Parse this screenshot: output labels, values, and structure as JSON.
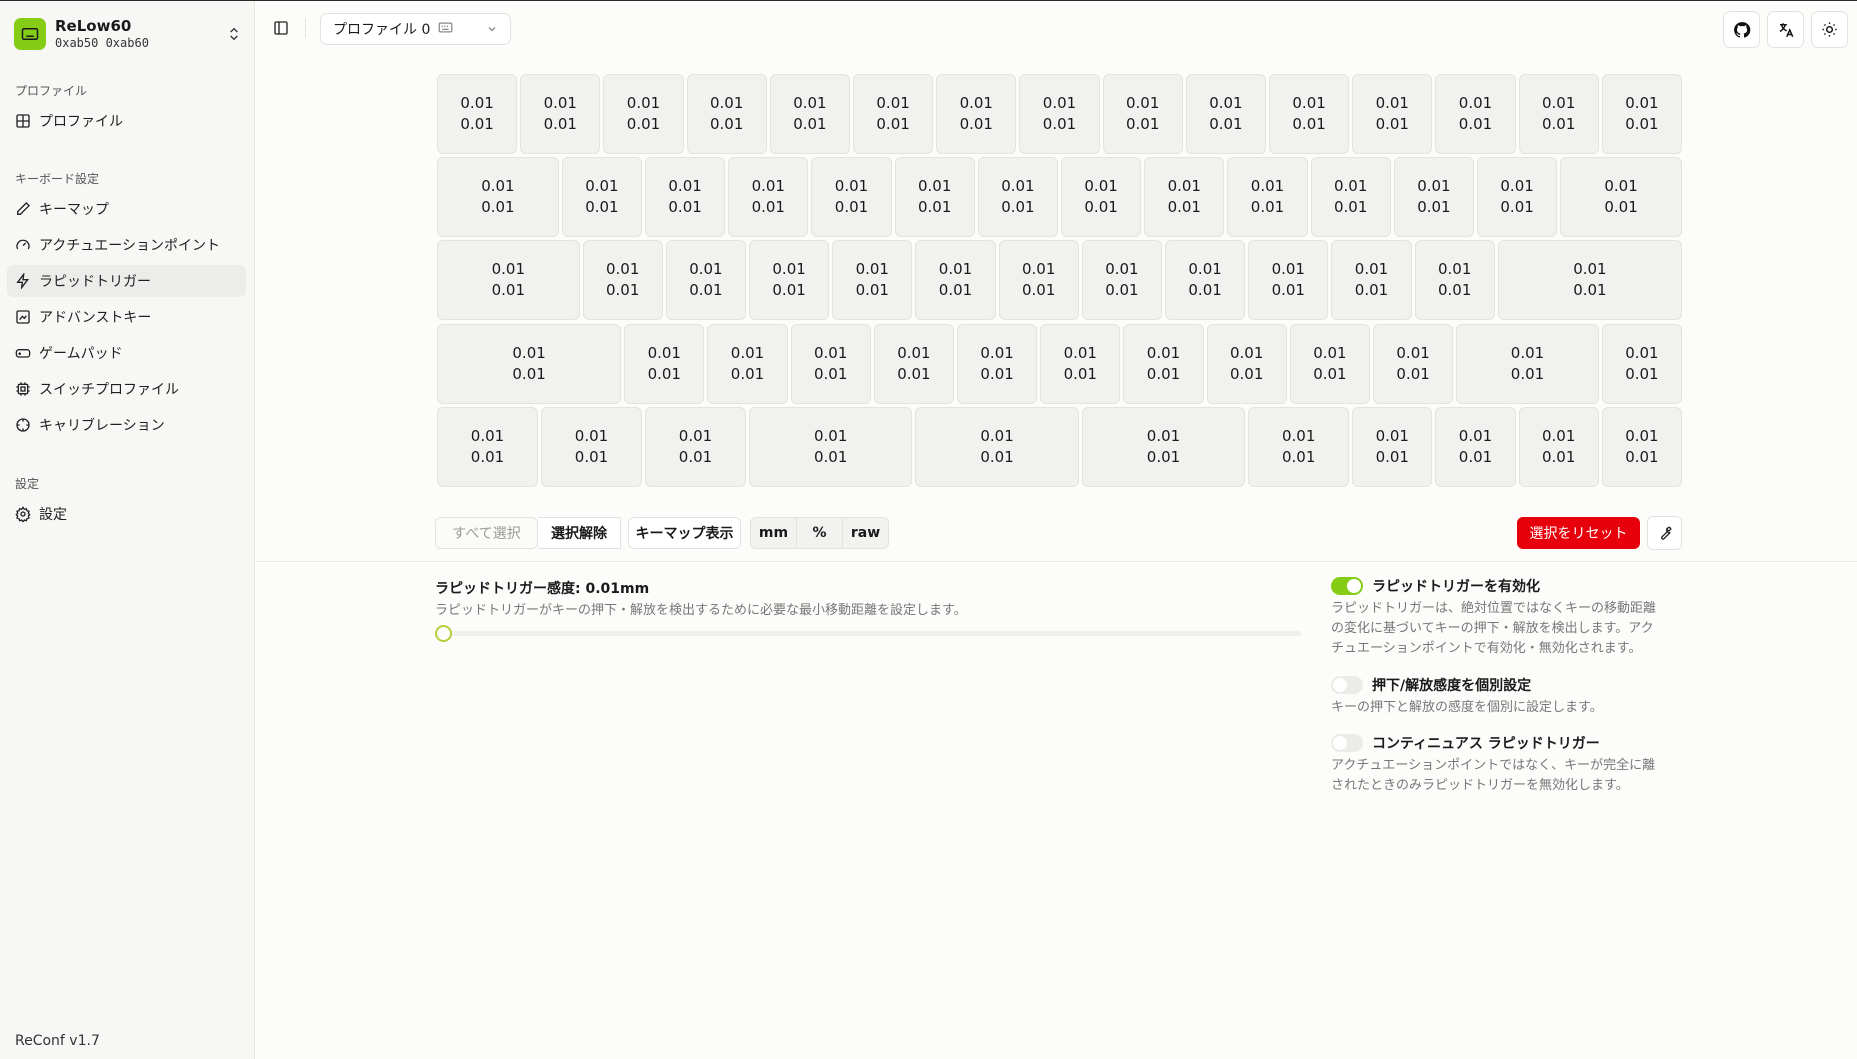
{
  "device": {
    "name": "ReLow60",
    "id": "0xab50 0xab60"
  },
  "sidebar": {
    "sections": [
      {
        "label": "プロファイル"
      },
      {
        "label": "キーボード設定"
      },
      {
        "label": "設定"
      }
    ],
    "items": [
      {
        "label": "プロファイル",
        "icon": "grid-icon"
      },
      {
        "label": "キーマップ",
        "icon": "pencil-icon"
      },
      {
        "label": "アクチュエーションポイント",
        "icon": "gauge-icon"
      },
      {
        "label": "ラピッドトリガー",
        "icon": "zap-icon",
        "active": true
      },
      {
        "label": "アドバンストキー",
        "icon": "chart-square-icon"
      },
      {
        "label": "ゲームパッド",
        "icon": "gamepad-icon"
      },
      {
        "label": "スイッチプロファイル",
        "icon": "cpu-icon"
      },
      {
        "label": "キャリブレーション",
        "icon": "crosshair-icon"
      },
      {
        "label": "設定",
        "icon": "gear-icon"
      }
    ],
    "version": "ReConf v1.7"
  },
  "topbar": {
    "profile_label": "プロファイル 0",
    "github_icon": "github-icon",
    "language_icon": "translate-icon",
    "theme_icon": "sun-icon"
  },
  "keyboard": {
    "rows": [
      [
        {
          "w": 1,
          "a": "0.01",
          "b": "0.01"
        },
        {
          "w": 1,
          "a": "0.01",
          "b": "0.01"
        },
        {
          "w": 1,
          "a": "0.01",
          "b": "0.01"
        },
        {
          "w": 1,
          "a": "0.01",
          "b": "0.01"
        },
        {
          "w": 1,
          "a": "0.01",
          "b": "0.01"
        },
        {
          "w": 1,
          "a": "0.01",
          "b": "0.01"
        },
        {
          "w": 1,
          "a": "0.01",
          "b": "0.01"
        },
        {
          "w": 1,
          "a": "0.01",
          "b": "0.01"
        },
        {
          "w": 1,
          "a": "0.01",
          "b": "0.01"
        },
        {
          "w": 1,
          "a": "0.01",
          "b": "0.01"
        },
        {
          "w": 1,
          "a": "0.01",
          "b": "0.01"
        },
        {
          "w": 1,
          "a": "0.01",
          "b": "0.01"
        },
        {
          "w": 1,
          "a": "0.01",
          "b": "0.01"
        },
        {
          "w": 1,
          "a": "0.01",
          "b": "0.01"
        },
        {
          "w": 1,
          "a": "0.01",
          "b": "0.01"
        }
      ],
      [
        {
          "w": 1.5,
          "a": "0.01",
          "b": "0.01"
        },
        {
          "w": 1,
          "a": "0.01",
          "b": "0.01"
        },
        {
          "w": 1,
          "a": "0.01",
          "b": "0.01"
        },
        {
          "w": 1,
          "a": "0.01",
          "b": "0.01"
        },
        {
          "w": 1,
          "a": "0.01",
          "b": "0.01"
        },
        {
          "w": 1,
          "a": "0.01",
          "b": "0.01"
        },
        {
          "w": 1,
          "a": "0.01",
          "b": "0.01"
        },
        {
          "w": 1,
          "a": "0.01",
          "b": "0.01"
        },
        {
          "w": 1,
          "a": "0.01",
          "b": "0.01"
        },
        {
          "w": 1,
          "a": "0.01",
          "b": "0.01"
        },
        {
          "w": 1,
          "a": "0.01",
          "b": "0.01"
        },
        {
          "w": 1,
          "a": "0.01",
          "b": "0.01"
        },
        {
          "w": 1,
          "a": "0.01",
          "b": "0.01"
        },
        {
          "w": 1.5,
          "a": "0.01",
          "b": "0.01"
        }
      ],
      [
        {
          "w": 1.75,
          "a": "0.01",
          "b": "0.01"
        },
        {
          "w": 1,
          "a": "0.01",
          "b": "0.01"
        },
        {
          "w": 1,
          "a": "0.01",
          "b": "0.01"
        },
        {
          "w": 1,
          "a": "0.01",
          "b": "0.01"
        },
        {
          "w": 1,
          "a": "0.01",
          "b": "0.01"
        },
        {
          "w": 1,
          "a": "0.01",
          "b": "0.01"
        },
        {
          "w": 1,
          "a": "0.01",
          "b": "0.01"
        },
        {
          "w": 1,
          "a": "0.01",
          "b": "0.01"
        },
        {
          "w": 1,
          "a": "0.01",
          "b": "0.01"
        },
        {
          "w": 1,
          "a": "0.01",
          "b": "0.01"
        },
        {
          "w": 1,
          "a": "0.01",
          "b": "0.01"
        },
        {
          "w": 1,
          "a": "0.01",
          "b": "0.01"
        },
        {
          "w": 2.25,
          "a": "0.01",
          "b": "0.01"
        }
      ],
      [
        {
          "w": 2.25,
          "a": "0.01",
          "b": "0.01"
        },
        {
          "w": 1,
          "a": "0.01",
          "b": "0.01"
        },
        {
          "w": 1,
          "a": "0.01",
          "b": "0.01"
        },
        {
          "w": 1,
          "a": "0.01",
          "b": "0.01"
        },
        {
          "w": 1,
          "a": "0.01",
          "b": "0.01"
        },
        {
          "w": 1,
          "a": "0.01",
          "b": "0.01"
        },
        {
          "w": 1,
          "a": "0.01",
          "b": "0.01"
        },
        {
          "w": 1,
          "a": "0.01",
          "b": "0.01"
        },
        {
          "w": 1,
          "a": "0.01",
          "b": "0.01"
        },
        {
          "w": 1,
          "a": "0.01",
          "b": "0.01"
        },
        {
          "w": 1,
          "a": "0.01",
          "b": "0.01"
        },
        {
          "w": 1.75,
          "a": "0.01",
          "b": "0.01"
        },
        {
          "w": 1,
          "a": "0.01",
          "b": "0.01"
        }
      ],
      [
        {
          "w": 1.25,
          "a": "0.01",
          "b": "0.01"
        },
        {
          "w": 1.25,
          "a": "0.01",
          "b": "0.01"
        },
        {
          "w": 1.25,
          "a": "0.01",
          "b": "0.01"
        },
        {
          "w": 2,
          "a": "0.01",
          "b": "0.01"
        },
        {
          "w": 2,
          "a": "0.01",
          "b": "0.01"
        },
        {
          "w": 2,
          "a": "0.01",
          "b": "0.01"
        },
        {
          "w": 1.25,
          "a": "0.01",
          "b": "0.01"
        },
        {
          "w": 1,
          "a": "0.01",
          "b": "0.01"
        },
        {
          "w": 1,
          "a": "0.01",
          "b": "0.01"
        },
        {
          "w": 1,
          "a": "0.01",
          "b": "0.01"
        },
        {
          "w": 1,
          "a": "0.01",
          "b": "0.01"
        }
      ]
    ]
  },
  "toolbar": {
    "select_all": "すべて選択",
    "deselect": "選択解除",
    "show_keymap": "キーマップ表示",
    "units": [
      "mm",
      "%",
      "raw"
    ],
    "reset": "選択をリセット",
    "wrench_icon": "wrench-icon"
  },
  "sensitivity": {
    "title": "ラピッドトリガー感度: 0.01mm",
    "description": "ラピッドトリガーがキーの押下・解放を検出するために必要な最小移動距離を設定します。",
    "slider_fraction": 0
  },
  "options": [
    {
      "title": "ラピッドトリガーを有効化",
      "on": true,
      "desc_lines": [
        "ラピッドトリガーは、絶対位置ではなくキーの移動距離",
        "の変化に基づいてキーの押下・解放を検出します。アク",
        "チュエーションポイントで有効化・無効化されます。"
      ]
    },
    {
      "title": "押下/解放感度を個別設定",
      "on": false,
      "desc_lines": [
        "キーの押下と解放の感度を個別に設定します。"
      ]
    },
    {
      "title": "コンティニュアス ラピッドトリガー",
      "on": false,
      "desc_lines": [
        "アクチュエーションポイントではなく、キーが完全に離",
        "されたときのみラピッドトリガーを無効化します。"
      ]
    }
  ],
  "colors": {
    "accent": "#84cc16",
    "danger": "#e7000b"
  }
}
